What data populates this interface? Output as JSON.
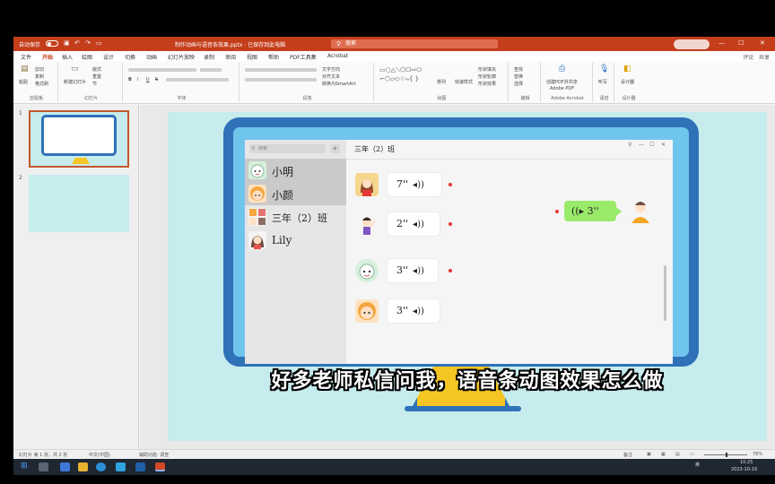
{
  "window": {
    "autosave_label": "自动保存",
    "autosave_state": "关",
    "doc_title": "制作动画与语音条效果.pptx · 已保存到此电脑",
    "search_placeholder": "搜索",
    "min": "—",
    "max": "☐",
    "close": "✕"
  },
  "ribbon_tabs": [
    "文件",
    "开始",
    "插入",
    "绘图",
    "设计",
    "切换",
    "动画",
    "幻灯片放映",
    "录制",
    "审阅",
    "视图",
    "帮助",
    "PDF工具集",
    "Acrobat"
  ],
  "ribbon_tabs_right": [
    "评论",
    "共享"
  ],
  "ribbon_groups": [
    {
      "label": "剪贴板",
      "items": [
        "粘贴",
        "剪切",
        "复制",
        "格式刷"
      ]
    },
    {
      "label": "幻灯片",
      "items": [
        "新建幻灯片",
        "版式",
        "重置",
        "节"
      ]
    },
    {
      "label": "字体",
      "items": [
        "B",
        "I",
        "U",
        "S"
      ]
    },
    {
      "label": "段落",
      "items": [
        "文字方向",
        "对齐文本",
        "转换为SmartArt"
      ]
    },
    {
      "label": "绘图",
      "items": [
        "排列",
        "快速样式",
        "形状填充",
        "形状轮廓",
        "形状效果"
      ]
    },
    {
      "label": "编辑",
      "items": [
        "查找",
        "替换",
        "选择"
      ]
    },
    {
      "label": "Adobe Acrobat",
      "items": [
        "创建PDF并共享",
        "Adobe PDF"
      ]
    },
    {
      "label": "语音",
      "items": [
        "听写"
      ]
    },
    {
      "label": "设计器",
      "items": [
        "设计器"
      ]
    }
  ],
  "thumbnails": [
    {
      "num": "1"
    },
    {
      "num": "2"
    }
  ],
  "chat": {
    "search_placeholder": "搜索",
    "add": "+",
    "contacts": [
      {
        "name": "小明",
        "selected": true
      },
      {
        "name": "小颜",
        "selected": true
      },
      {
        "name": "三年（2）班",
        "selected": false
      },
      {
        "name": "Lily",
        "selected": false
      }
    ],
    "title": "三年（2）班",
    "window_controls": [
      "⚲",
      "—",
      "☐",
      "✕"
    ],
    "messages": [
      {
        "duration": "7''",
        "wave": "◂))"
      },
      {
        "duration": "2''",
        "wave": "◂))"
      },
      {
        "duration": "3''",
        "wave": "◂))"
      },
      {
        "duration": "3''",
        "wave": "◂))"
      }
    ],
    "outgoing": {
      "duration": "3''",
      "wave": "((▸"
    }
  },
  "caption": "好多老师私信问我，语音条动图效果怎么做",
  "statusbar": {
    "slide_info": "幻灯片 第 1 张，共 2 张",
    "language": "中文(中国)",
    "accessibility": "辅助功能: 调查",
    "notes": "备注",
    "zoom": "78%"
  },
  "taskbar": {
    "time": "10:25",
    "date": "2023-10-19",
    "ime": "英"
  },
  "colors": {
    "accent": "#c43e1c",
    "slide_bg": "#c6ecee",
    "monitor_frame": "#2f72b8",
    "monitor_screen": "#70c5ec",
    "stand": "#f5c623",
    "bubble_out": "#9aea6a",
    "unread_dot": "#e53935"
  }
}
